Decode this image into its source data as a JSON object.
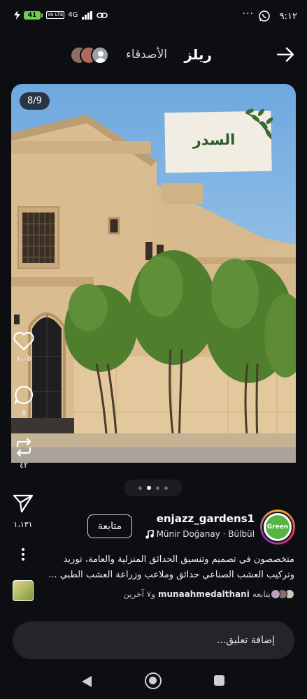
{
  "status_bar": {
    "time": "٩:١٢",
    "battery": "41",
    "network": "4G",
    "volte": "Vo LTE",
    "more": "···",
    "icons": [
      "whatsapp-icon",
      "bolt-icon",
      "signal-icon",
      "link-icon"
    ]
  },
  "header": {
    "title": "ريلز",
    "friends_label": "الأصدقاء",
    "icons": [
      "arrow-right-icon"
    ]
  },
  "post": {
    "counter": "8/9",
    "stamp_text": "السدر",
    "likes": "١،٠٥",
    "comments": "٥",
    "reposts": "٤٢",
    "shares": "١،١٣١",
    "pager_dots": 4,
    "pager_active": 1
  },
  "author": {
    "username": "enjazz_gardens1",
    "logo_text": "Green",
    "music": "Münir Doğanay · Bülbül",
    "follow_label": "متابعة"
  },
  "caption": {
    "line1": "متخصصون في تصميم وتنسيق الحدائق المنزلية والعامة، توريد",
    "line2": "وتركيب العشب الصناعي حدائق وملاعب وزراعة العشب الطبي ..."
  },
  "followed_by": {
    "prefix": "يتابعه",
    "name": "munaahmedalthani",
    "suffix": "و٧ آخرين"
  },
  "comment": {
    "placeholder": "إضافة تعليق..."
  },
  "colors": {
    "background": "#0d0e12",
    "sky": "#8cbde7",
    "building": "#d9bc8f",
    "tree": "#4f7f2c",
    "accent_green": "#2e5b2c",
    "battery": "#6ad04a"
  }
}
